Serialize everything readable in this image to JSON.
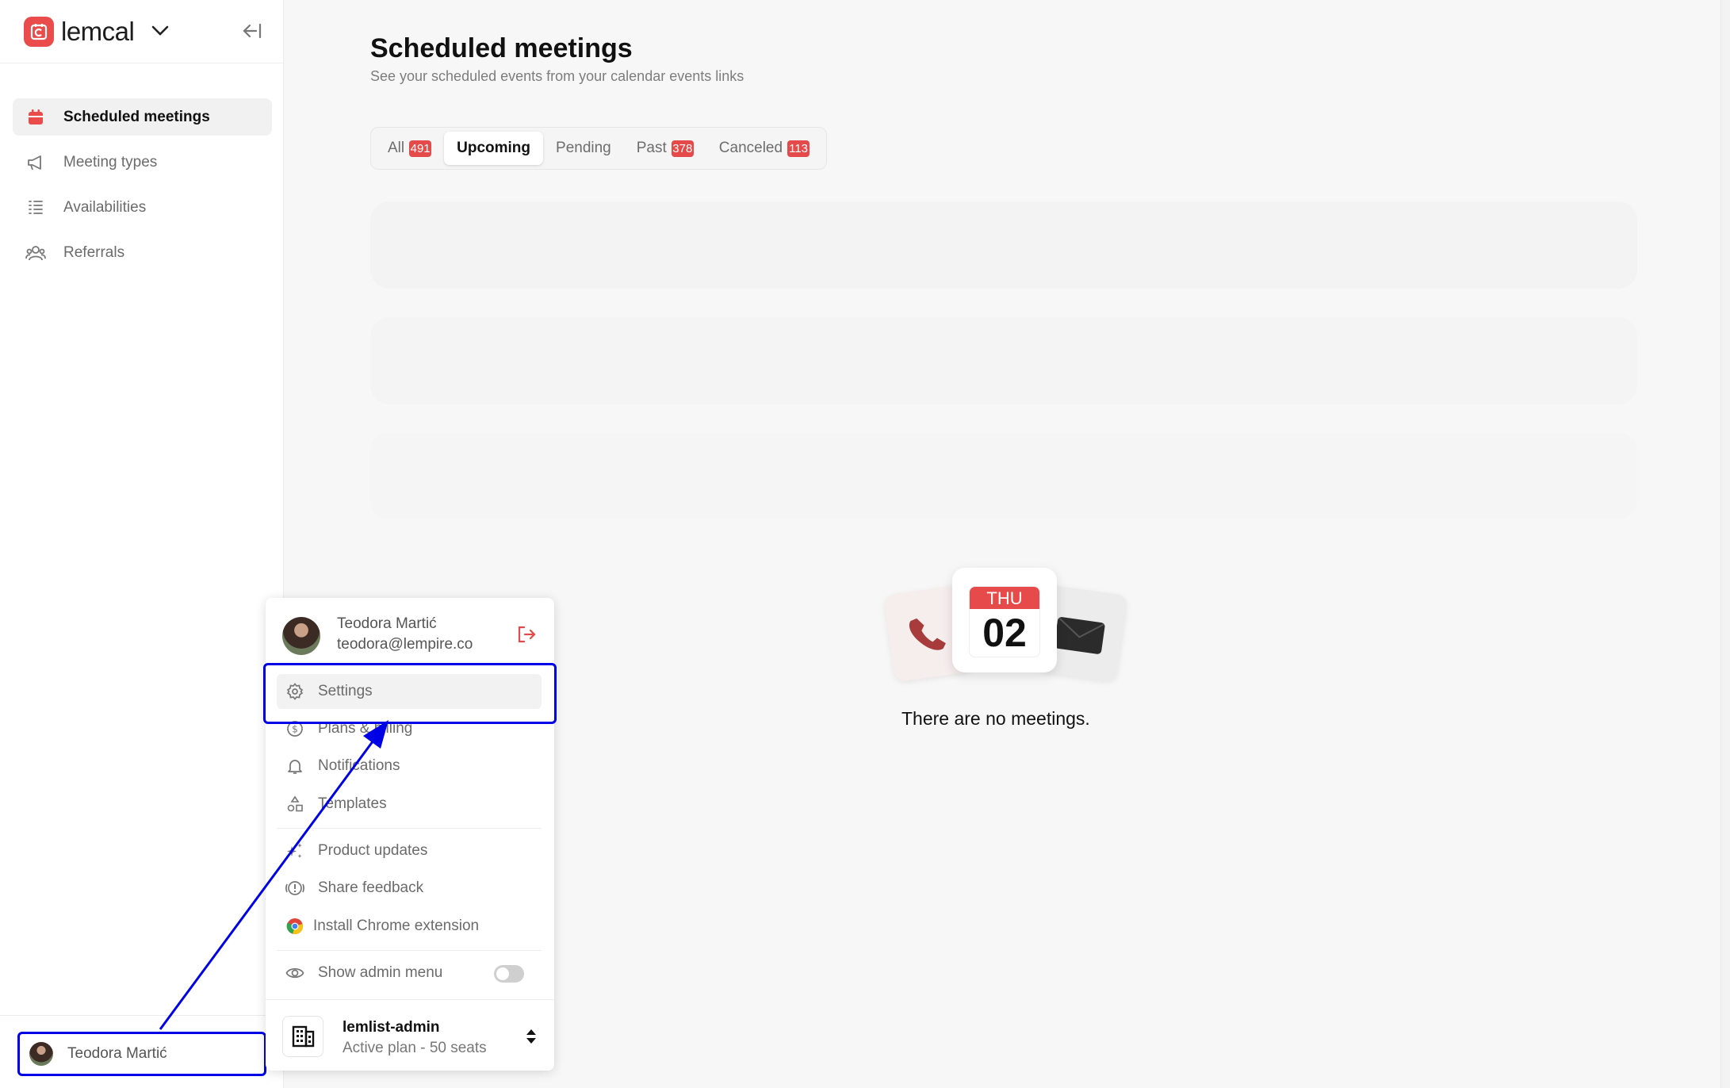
{
  "brand": {
    "name": "lemcal"
  },
  "sidebar": {
    "items": [
      {
        "label": "Scheduled meetings",
        "icon": "calendar-icon",
        "active": true
      },
      {
        "label": "Meeting types",
        "icon": "megaphone-icon",
        "active": false
      },
      {
        "label": "Availabilities",
        "icon": "list-icon",
        "active": false
      },
      {
        "label": "Referrals",
        "icon": "users-icon",
        "active": false
      }
    ],
    "user_name": "Teodora Martić"
  },
  "page": {
    "title": "Scheduled meetings",
    "subtitle": "See your scheduled events from your calendar events links"
  },
  "tabs": [
    {
      "label": "All",
      "count": "491"
    },
    {
      "label": "Upcoming",
      "count": "",
      "active": true
    },
    {
      "label": "Pending",
      "count": ""
    },
    {
      "label": "Past",
      "count": "378"
    },
    {
      "label": "Canceled",
      "count": "113"
    }
  ],
  "empty_state": {
    "calendar_day_name": "THU",
    "calendar_day_number": "02",
    "message": "There are no meetings."
  },
  "menu": {
    "user_name": "Teodora Martić",
    "user_email": "teodora@lempire.co",
    "items": [
      {
        "label": "Settings",
        "icon": "gear-icon"
      },
      {
        "label": "Plans & billing",
        "icon": "dollar-icon"
      },
      {
        "label": "Notifications",
        "icon": "bell-icon"
      },
      {
        "label": "Templates",
        "icon": "shapes-icon"
      },
      {
        "label": "Product updates",
        "icon": "sparkle-icon"
      },
      {
        "label": "Share feedback",
        "icon": "feedback-icon"
      },
      {
        "label": "Install Chrome extension",
        "icon": "chrome-icon"
      },
      {
        "label": "Show admin menu",
        "icon": "eye-icon"
      }
    ],
    "admin_menu_enabled": false,
    "org": {
      "name": "lemlist-admin",
      "plan": "Active plan - 50 seats"
    }
  },
  "colors": {
    "accent": "#ea4b4b",
    "annotation": "#0000e6"
  }
}
